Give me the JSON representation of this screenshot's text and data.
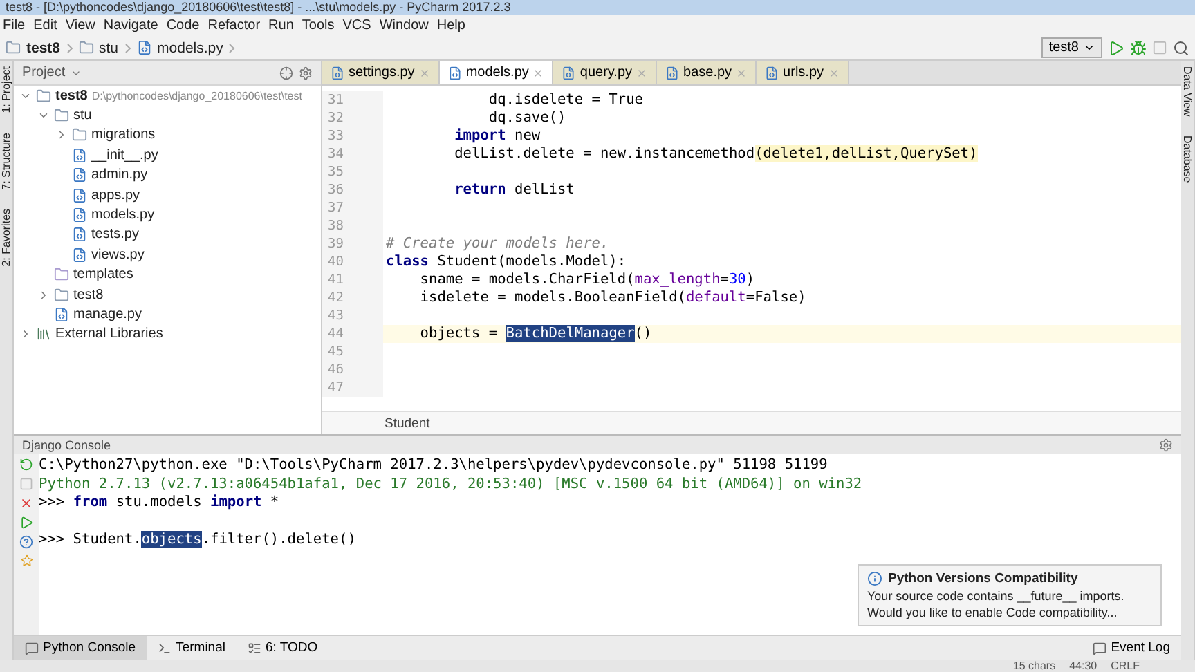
{
  "window": {
    "title": "test8 - [D:\\pythoncodes\\django_20180606\\test\\test8] - ...\\stu\\models.py - PyCharm 2017.2.3"
  },
  "menu": [
    "File",
    "Edit",
    "View",
    "Navigate",
    "Code",
    "Refactor",
    "Run",
    "Tools",
    "VCS",
    "Window",
    "Help"
  ],
  "breadcrumbs": [
    {
      "label": "test8",
      "kind": "project"
    },
    {
      "label": "stu",
      "kind": "folder"
    },
    {
      "label": "models.py",
      "kind": "file"
    }
  ],
  "run_config": {
    "label": "test8"
  },
  "left_strip": [
    "1: Project",
    "7: Structure",
    "2: Favorites"
  ],
  "right_strip": [
    "Data View",
    "Database"
  ],
  "project": {
    "title": "Project",
    "tree": [
      {
        "label": "test8",
        "path": "D:\\pythoncodes\\django_20180606\\test\\test",
        "kind": "project",
        "expanded": true,
        "children": [
          {
            "label": "stu",
            "kind": "folder",
            "expanded": true,
            "children": [
              {
                "label": "migrations",
                "kind": "folder",
                "expanded": false
              },
              {
                "label": "__init__.py",
                "kind": "file"
              },
              {
                "label": "admin.py",
                "kind": "file"
              },
              {
                "label": "apps.py",
                "kind": "file"
              },
              {
                "label": "models.py",
                "kind": "file"
              },
              {
                "label": "tests.py",
                "kind": "file"
              },
              {
                "label": "views.py",
                "kind": "file"
              }
            ]
          },
          {
            "label": "templates",
            "kind": "template"
          },
          {
            "label": "test8",
            "kind": "folder",
            "expanded": false
          },
          {
            "label": "manage.py",
            "kind": "file"
          }
        ]
      },
      {
        "label": "External Libraries",
        "kind": "library",
        "expanded": false
      }
    ]
  },
  "tabs": [
    {
      "label": "settings.py",
      "selected": false
    },
    {
      "label": "models.py",
      "selected": true
    },
    {
      "label": "query.py",
      "selected": false
    },
    {
      "label": "base.py",
      "selected": false
    },
    {
      "label": "urls.py",
      "selected": false
    }
  ],
  "code": [
    {
      "n": "31",
      "current": false,
      "tokens": [
        {
          "kind": "plain",
          "text": "            dq.isdelete = True"
        }
      ]
    },
    {
      "n": "32",
      "current": false,
      "tokens": [
        {
          "kind": "plain",
          "text": "            dq.save()"
        }
      ]
    },
    {
      "n": "33",
      "current": false,
      "tokens": [
        {
          "kind": "keyword",
          "text": "        import"
        },
        {
          "kind": "plain",
          "text": " new"
        }
      ]
    },
    {
      "n": "34",
      "current": false,
      "tokens": [
        {
          "kind": "plain",
          "text": "        delList.delete = new.instancemethod"
        },
        {
          "kind": "hint",
          "text": "(delete1,delList,QuerySet)"
        }
      ]
    },
    {
      "n": "35",
      "current": false
    },
    {
      "n": "36",
      "current": false,
      "tokens": [
        {
          "kind": "keyword",
          "text": "        return"
        },
        {
          "kind": "plain",
          "text": " delList"
        }
      ]
    },
    {
      "n": "37",
      "current": false
    },
    {
      "n": "38",
      "current": false
    },
    {
      "n": "39",
      "current": false,
      "tokens": [
        {
          "kind": "comment",
          "text": "# Create your models here."
        }
      ]
    },
    {
      "n": "40",
      "current": false,
      "tokens": [
        {
          "kind": "keyword",
          "text": "class"
        },
        {
          "kind": "plain",
          "text": " Student(models.Model):"
        }
      ]
    },
    {
      "n": "41",
      "current": false,
      "tokens": [
        {
          "kind": "plain",
          "text": "    sname = models.CharField("
        },
        {
          "kind": "param",
          "text": "max_length"
        },
        {
          "kind": "plain",
          "text": "="
        },
        {
          "kind": "number",
          "text": "30"
        },
        {
          "kind": "plain",
          "text": ")"
        }
      ]
    },
    {
      "n": "42",
      "current": false,
      "tokens": [
        {
          "kind": "plain",
          "text": "    isdelete = models.BooleanField("
        },
        {
          "kind": "param",
          "text": "default"
        },
        {
          "kind": "plain",
          "text": "=False)"
        }
      ]
    },
    {
      "n": "43",
      "current": false
    },
    {
      "n": "44",
      "current": true,
      "tokens": [
        {
          "kind": "plain",
          "text": "    objects = "
        },
        {
          "kind": "selection",
          "text": "BatchDelManager"
        },
        {
          "kind": "plain",
          "text": "()"
        }
      ]
    },
    {
      "n": "45",
      "current": false
    },
    {
      "n": "46",
      "current": false
    },
    {
      "n": "47",
      "current": false
    }
  ],
  "editor_breadcrumb": "Student",
  "console": {
    "title": "Django Console",
    "lines": [
      {
        "tokens": [
          {
            "kind": "plain",
            "text": "C:\\Python27\\python.exe \"D:\\Tools\\PyCharm 2017.2.3\\helpers\\pydev\\pydevconsole.py\" 51198 51199"
          }
        ]
      },
      {
        "tokens": [
          {
            "kind": "info",
            "text": "Python 2.7.13 (v2.7.13:a06454b1afa1, Dec 17 2016, 20:53:40) [MSC v.1500 64 bit (AMD64)] on win32"
          }
        ]
      },
      {
        "tokens": [
          {
            "kind": "plain",
            "text": ">>> "
          },
          {
            "kind": "keyword",
            "text": "from"
          },
          {
            "kind": "plain",
            "text": " stu.models "
          },
          {
            "kind": "keyword",
            "text": "import"
          },
          {
            "kind": "plain",
            "text": " *"
          }
        ]
      },
      {
        "gap_before": true,
        "tokens": [
          {
            "kind": "plain",
            "text": ">>> Student."
          },
          {
            "kind": "selection",
            "text": "objects"
          },
          {
            "kind": "plain",
            "text": ".filter().delete()"
          }
        ]
      }
    ]
  },
  "notification": {
    "title": "Python Versions Compatibility",
    "lines": [
      "Your source code contains __future__ imports.",
      "Would you like to enable Code compatibility..."
    ]
  },
  "tool_tabs": [
    {
      "label": "Python Console",
      "selected": true
    },
    {
      "label": "Terminal",
      "selected": false
    },
    {
      "label": "6: TODO",
      "selected": false
    }
  ],
  "event_log": "Event Log",
  "status": [
    "15 chars",
    "44:30",
    "CRLF"
  ]
}
